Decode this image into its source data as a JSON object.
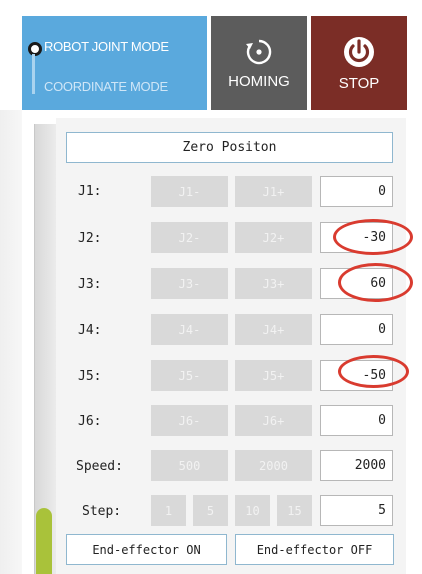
{
  "header": {
    "mode_options": [
      "ROBOT JOINT MODE",
      "COORDINATE MODE"
    ],
    "homing_label": "HOMING",
    "stop_label": "STOP"
  },
  "zero_position_label": "Zero Positon",
  "joints": [
    {
      "label": "J1:",
      "minus": "J1-",
      "plus": "J1+",
      "value": "0"
    },
    {
      "label": "J2:",
      "minus": "J2-",
      "plus": "J2+",
      "value": "-30"
    },
    {
      "label": "J3:",
      "minus": "J3-",
      "plus": "J3+",
      "value": "60"
    },
    {
      "label": "J4:",
      "minus": "J4-",
      "plus": "J4+",
      "value": "0"
    },
    {
      "label": "J5:",
      "minus": "J5-",
      "plus": "J5+",
      "value": "-50"
    },
    {
      "label": "J6:",
      "minus": "J6-",
      "plus": "J6+",
      "value": "0"
    }
  ],
  "speed": {
    "label": "Speed:",
    "options": [
      "500",
      "2000"
    ],
    "value": "2000"
  },
  "step": {
    "label": "Step:",
    "options": [
      "1",
      "5",
      "10",
      "15"
    ],
    "value": "5"
  },
  "end_effector": {
    "on_label": "End-effector ON",
    "off_label": "End-effector OFF"
  },
  "colors": {
    "accent_blue": "#5aa9dd",
    "stop_red": "#7b2d26",
    "highlight_ring": "#d93b2f",
    "scroll_thumb": "#a9c23a"
  }
}
